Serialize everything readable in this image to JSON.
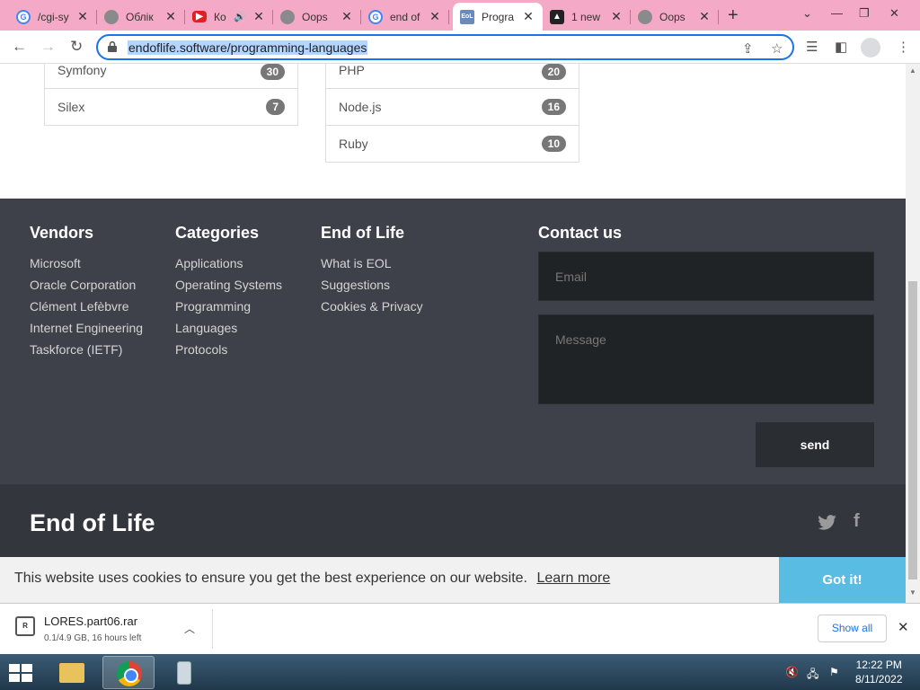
{
  "browser": {
    "tabs": [
      {
        "title": "/cgi-sy",
        "icon": "google-icon"
      },
      {
        "title": "Облік",
        "icon": "globe-icon"
      },
      {
        "title": "Ко",
        "icon": "youtube-icon"
      },
      {
        "title": "Oops",
        "icon": "globe-icon"
      },
      {
        "title": "end of",
        "icon": "google-icon"
      },
      {
        "title": "Progra",
        "icon": "endoflife-icon",
        "active": true
      },
      {
        "title": "1 new",
        "icon": "cloud-icon"
      },
      {
        "title": "Oops",
        "icon": "globe-icon"
      }
    ],
    "url": "endoflife.software/programming-languages"
  },
  "lists": {
    "left": [
      {
        "label": "Symfony",
        "count": "30"
      },
      {
        "label": "Silex",
        "count": "7"
      }
    ],
    "right": [
      {
        "label": "PHP",
        "count": "20"
      },
      {
        "label": "Node.js",
        "count": "16"
      },
      {
        "label": "Ruby",
        "count": "10"
      }
    ]
  },
  "footer": {
    "vendors": {
      "title": "Vendors",
      "items": [
        "Microsoft",
        "Oracle Corporation",
        "Clément Lefèbvre",
        "Internet Engineering",
        "Taskforce (IETF)"
      ]
    },
    "categories": {
      "title": "Categories",
      "items": [
        "Applications",
        "Operating Systems",
        "Programming",
        "Languages",
        "Protocols"
      ]
    },
    "eol": {
      "title": "End of Life",
      "items": [
        "What is EOL",
        "Suggestions",
        "Cookies & Privacy"
      ]
    },
    "contact": {
      "title": "Contact us",
      "email_placeholder": "Email",
      "message_placeholder": "Message",
      "send_label": "send"
    },
    "brand": "End of Life",
    "social": [
      "twitter-icon",
      "facebook-icon"
    ]
  },
  "cookie": {
    "text": "This website uses cookies to ensure you get the best experience on our website.",
    "link": "Learn more",
    "button": "Got it!"
  },
  "download": {
    "filename": "LORES.part06.rar",
    "status": "0.1/4.9 GB, 16 hours left",
    "show_all": "Show all"
  },
  "taskbar": {
    "time": "12:22 PM",
    "date": "8/11/2022"
  },
  "colors": {
    "tabstrip": "#f4a9c6",
    "footer": "#3e4149",
    "cookie_button": "#58bce3"
  }
}
